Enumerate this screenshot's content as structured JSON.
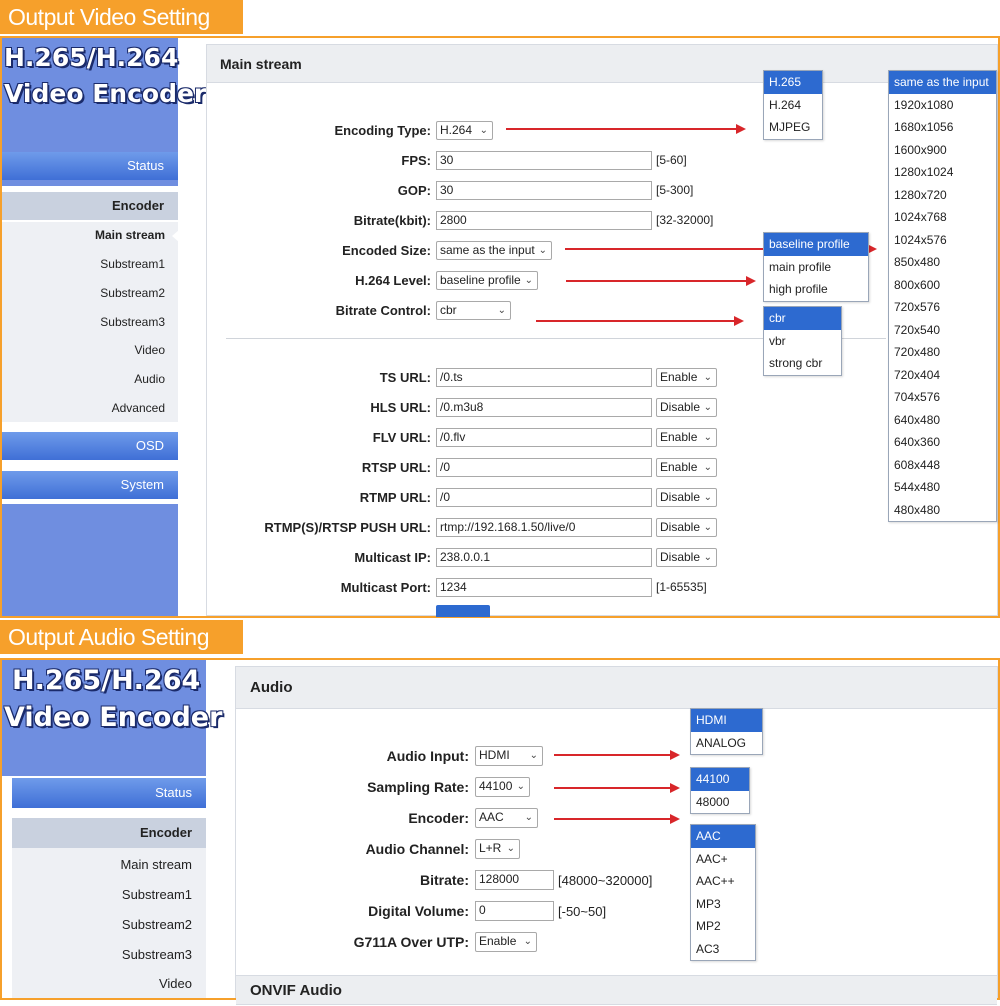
{
  "video": {
    "banner": "Output Video Setting",
    "logo_line1": "H.265/H.264",
    "logo_line2": "Video Encoder",
    "nav": {
      "status": "Status",
      "encoder": "Encoder",
      "sub_items": [
        "Main stream",
        "Substream1",
        "Substream2",
        "Substream3",
        "Video",
        "Audio",
        "Advanced"
      ],
      "osd": "OSD",
      "system": "System"
    },
    "panel_title": "Main stream",
    "fields": {
      "encoding_type": {
        "label": "Encoding Type:",
        "value": "H.264"
      },
      "fps": {
        "label": "FPS:",
        "value": "30",
        "hint": "[5-60]"
      },
      "gop": {
        "label": "GOP:",
        "value": "30",
        "hint": "[5-300]"
      },
      "bitrate": {
        "label": "Bitrate(kbit):",
        "value": "2800",
        "hint": "[32-32000]"
      },
      "encoded_size": {
        "label": "Encoded Size:",
        "value": "same as the input"
      },
      "h264_level": {
        "label": "H.264 Level:",
        "value": "baseline profile"
      },
      "bitrate_control": {
        "label": "Bitrate Control:",
        "value": "cbr"
      },
      "ts_url": {
        "label": "TS URL:",
        "value": "/0.ts",
        "state": "Enable"
      },
      "hls_url": {
        "label": "HLS URL:",
        "value": "/0.m3u8",
        "state": "Disable"
      },
      "flv_url": {
        "label": "FLV URL:",
        "value": "/0.flv",
        "state": "Enable"
      },
      "rtsp_url": {
        "label": "RTSP URL:",
        "value": "/0",
        "state": "Enable"
      },
      "rtmp_url": {
        "label": "RTMP URL:",
        "value": "/0",
        "state": "Disable"
      },
      "push_url": {
        "label": "RTMP(S)/RTSP PUSH URL:",
        "value": "rtmp://192.168.1.50/live/0",
        "state": "Disable"
      },
      "multicast_ip": {
        "label": "Multicast IP:",
        "value": "238.0.0.1",
        "state": "Disable"
      },
      "multicast_port": {
        "label": "Multicast Port:",
        "value": "1234",
        "hint": "[1-65535]"
      }
    },
    "dropdowns": {
      "encoding_type": [
        "H.265",
        "H.264",
        "MJPEG"
      ],
      "level": [
        "baseline profile",
        "main profile",
        "high profile"
      ],
      "bitrate_control": [
        "cbr",
        "vbr",
        "strong cbr"
      ],
      "size": [
        "same as the input",
        "1920x1080",
        "1680x1056",
        "1600x900",
        "1280x1024",
        "1280x720",
        "1024x768",
        "1024x576",
        "850x480",
        "800x600",
        "720x576",
        "720x540",
        "720x480",
        "720x404",
        "704x576",
        "640x480",
        "640x360",
        "608x448",
        "544x480",
        "480x480"
      ]
    }
  },
  "audio": {
    "banner": "Output Audio Setting",
    "logo_line1": "H.265/H.264",
    "logo_line2": "Video Encoder",
    "nav": {
      "status": "Status",
      "encoder": "Encoder",
      "sub_items": [
        "Main stream",
        "Substream1",
        "Substream2",
        "Substream3",
        "Video"
      ]
    },
    "panel_title": "Audio",
    "panel2_title": "ONVIF Audio",
    "fields": {
      "audio_input": {
        "label": "Audio Input:",
        "value": "HDMI"
      },
      "sampling_rate": {
        "label": "Sampling Rate:",
        "value": "44100"
      },
      "encoder": {
        "label": "Encoder:",
        "value": "AAC"
      },
      "audio_channel": {
        "label": "Audio Channel:",
        "value": "L+R"
      },
      "bitrate": {
        "label": "Bitrate:",
        "value": "128000",
        "hint": "[48000~320000]"
      },
      "digital_volume": {
        "label": "Digital Volume:",
        "value": "0",
        "hint": "[-50~50]"
      },
      "g711a": {
        "label": "G711A Over UTP:",
        "value": "Enable"
      }
    },
    "dropdowns": {
      "input": [
        "HDMI",
        "ANALOG"
      ],
      "rate": [
        "44100",
        "48000"
      ],
      "encoder": [
        "AAC",
        "AAC+",
        "AAC++",
        "MP3",
        "MP2",
        "AC3"
      ]
    }
  },
  "colors": {
    "banner": "#f6a02b",
    "nav_blue": "#3f6fd6",
    "selected": "#2d6ad0",
    "arrow": "#d8262a"
  }
}
